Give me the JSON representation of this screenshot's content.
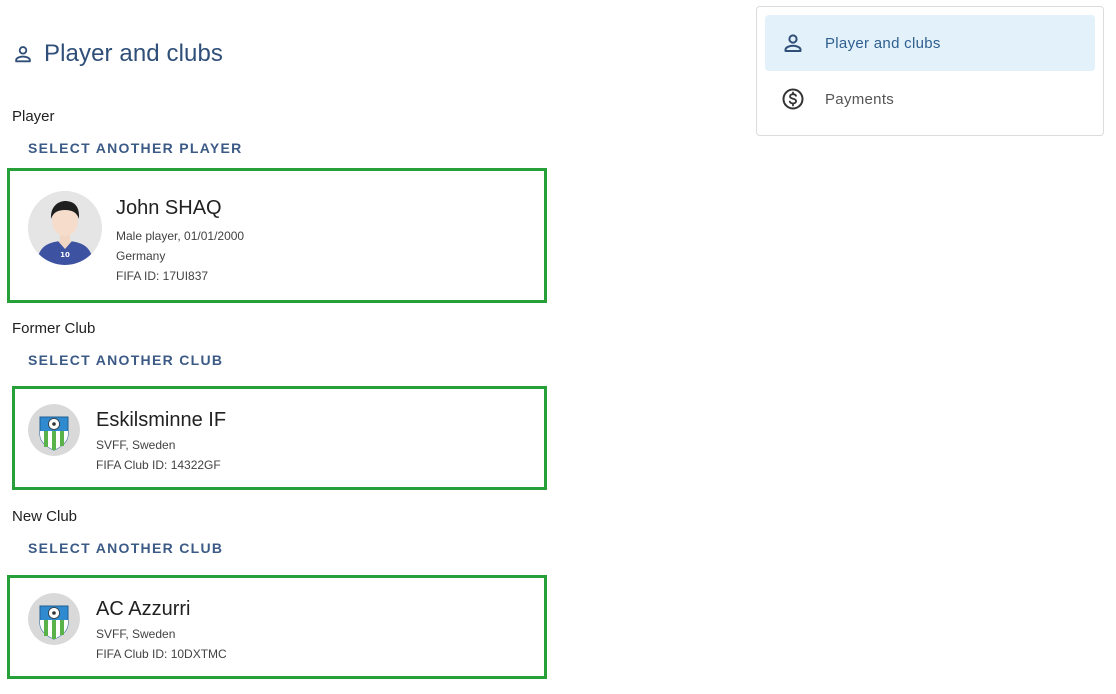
{
  "page": {
    "title": "Player and clubs",
    "title_icon": "person-icon"
  },
  "player_section": {
    "label": "Player",
    "action": "SELECT ANOTHER PLAYER",
    "card": {
      "name": "John SHAQ",
      "details": "Male player, 01/01/2000",
      "country": "Germany",
      "fifa_id": "FIFA ID: 17UI837",
      "avatar_icon": "player-avatar-icon",
      "jersey_number": "10"
    }
  },
  "former_club_section": {
    "label": "Former Club",
    "action": "SELECT ANOTHER CLUB",
    "card": {
      "name": "Eskilsminne IF",
      "federation": "SVFF, Sweden",
      "fifa_club_id": "FIFA Club ID: 14322GF",
      "crest_icon": "club-crest-icon"
    }
  },
  "new_club_section": {
    "label": "New Club",
    "action": "SELECT ANOTHER CLUB",
    "card": {
      "name": "AC Azzurri",
      "federation": "SVFF, Sweden",
      "fifa_club_id": "FIFA Club ID: 10DXTMC",
      "crest_icon": "club-crest-icon"
    }
  },
  "side_menu": {
    "items": [
      {
        "label": "Player and clubs",
        "icon": "person-icon",
        "active": true
      },
      {
        "label": "Payments",
        "icon": "dollar-circle-icon",
        "active": false
      }
    ]
  },
  "colors": {
    "accent": "#3c5a86",
    "card_border": "#28a03a",
    "active_menu_bg": "#e3f1fa"
  }
}
